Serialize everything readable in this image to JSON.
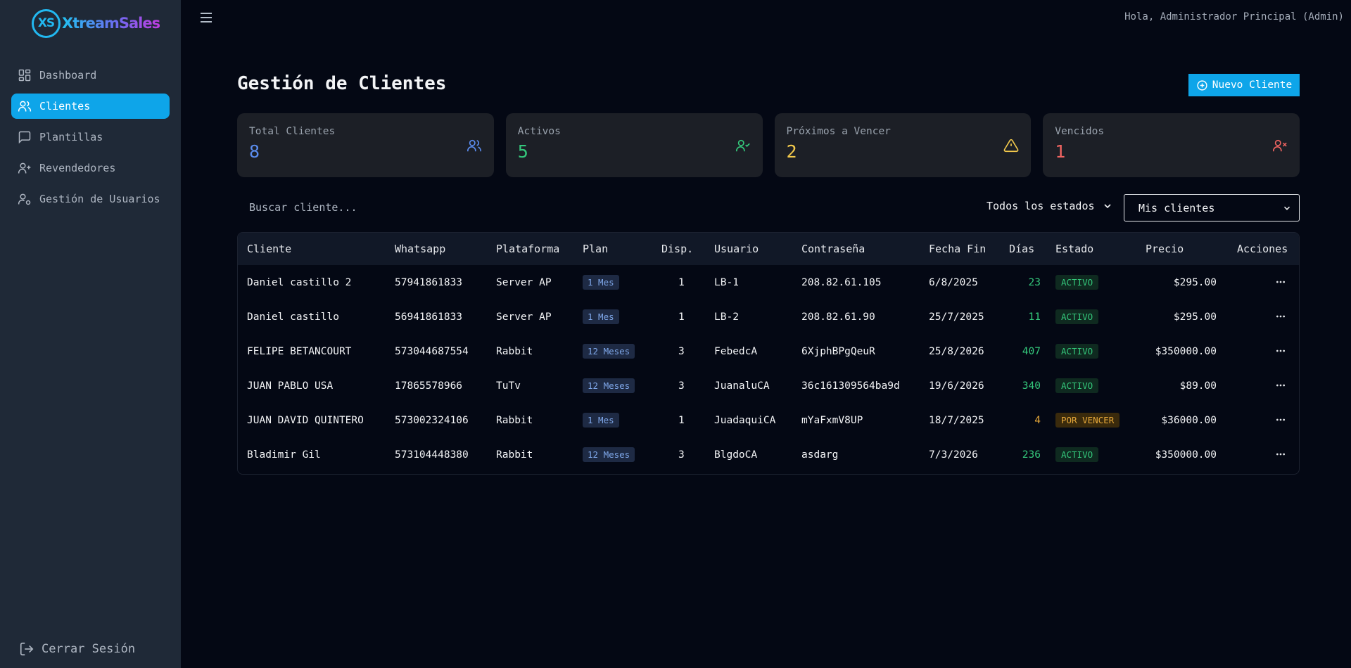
{
  "brand": {
    "mark": "XS",
    "name": "XtreamSales"
  },
  "sidebar": {
    "items": [
      {
        "label": "Dashboard",
        "icon": "dashboard-icon",
        "active": false
      },
      {
        "label": "Clientes",
        "icon": "users-icon",
        "active": true
      },
      {
        "label": "Plantillas",
        "icon": "message-icon",
        "active": false
      },
      {
        "label": "Revendedores",
        "icon": "user-plus-icon",
        "active": false
      },
      {
        "label": "Gestión de Usuarios",
        "icon": "user-cog-icon",
        "active": false
      }
    ],
    "logout_label": "Cerrar Sesión"
  },
  "header": {
    "greeting": "Hola, Administrador Principal (Admin)"
  },
  "page": {
    "title": "Gestión de Clientes",
    "new_button": "Nuevo Cliente"
  },
  "stats": [
    {
      "label": "Total Clientes",
      "value": "8",
      "color": "#5b8def",
      "icon": "users-icon"
    },
    {
      "label": "Activos",
      "value": "5",
      "color": "#34c77b",
      "icon": "user-check-icon"
    },
    {
      "label": "Próximos a Vencer",
      "value": "2",
      "color": "#f2c94c",
      "icon": "warning-icon"
    },
    {
      "label": "Vencidos",
      "value": "1",
      "color": "#ef6461",
      "icon": "user-x-icon"
    }
  ],
  "filters": {
    "search_placeholder": "Buscar cliente...",
    "state_selected": "Todos los estados",
    "owner_selected": "Mis clientes"
  },
  "table": {
    "columns": [
      "Cliente",
      "Whatsapp",
      "Plataforma",
      "Plan",
      "Disp.",
      "Usuario",
      "Contraseña",
      "Fecha Fin",
      "Días",
      "Estado",
      "Precio",
      "Acciones"
    ],
    "rows": [
      {
        "cliente": "Daniel castillo 2",
        "whatsapp": "57941861833",
        "plataforma": "Server AP",
        "plan": "1 Mes",
        "disp": "1",
        "usuario": "LB-1",
        "contrasena": "208.82.61.105",
        "fecha_fin": "6/8/2025",
        "dias": "23",
        "dias_color": "#34c77b",
        "estado": "ACTIVO",
        "estado_kind": "active",
        "precio": "$295.00"
      },
      {
        "cliente": "Daniel castillo",
        "whatsapp": "56941861833",
        "plataforma": "Server AP",
        "plan": "1 Mes",
        "disp": "1",
        "usuario": "LB-2",
        "contrasena": "208.82.61.90",
        "fecha_fin": "25/7/2025",
        "dias": "11",
        "dias_color": "#34c77b",
        "estado": "ACTIVO",
        "estado_kind": "active",
        "precio": "$295.00"
      },
      {
        "cliente": "FELIPE BETANCOURT",
        "whatsapp": "573044687554",
        "plataforma": "Rabbit",
        "plan": "12 Meses",
        "disp": "3",
        "usuario": "FebedcA",
        "contrasena": "6XjphBPgQeuR",
        "fecha_fin": "25/8/2026",
        "dias": "407",
        "dias_color": "#34c77b",
        "estado": "ACTIVO",
        "estado_kind": "active",
        "precio": "$350000.00"
      },
      {
        "cliente": "JUAN PABLO USA",
        "whatsapp": "17865578966",
        "plataforma": "TuTv",
        "plan": "12 Meses",
        "disp": "3",
        "usuario": "JuanaluCA",
        "contrasena": "36c161309564ba9d",
        "fecha_fin": "19/6/2026",
        "dias": "340",
        "dias_color": "#34c77b",
        "estado": "ACTIVO",
        "estado_kind": "active",
        "precio": "$89.00"
      },
      {
        "cliente": "JUAN DAVID QUINTERO",
        "whatsapp": "573002324106",
        "plataforma": "Rabbit",
        "plan": "1 Mes",
        "disp": "1",
        "usuario": "JuadaquiCA",
        "contrasena": "mYaFxmV8UP",
        "fecha_fin": "18/7/2025",
        "dias": "4",
        "dias_color": "#e8a93a",
        "estado": "POR VENCER",
        "estado_kind": "soon",
        "precio": "$36000.00"
      },
      {
        "cliente": "Bladimir Gil",
        "whatsapp": "573104448380",
        "plataforma": "Rabbit",
        "plan": "12 Meses",
        "disp": "3",
        "usuario": "BlgdoCA",
        "contrasena": "asdarg",
        "fecha_fin": "7/3/2026",
        "dias": "236",
        "dias_color": "#34c77b",
        "estado": "ACTIVO",
        "estado_kind": "active",
        "precio": "$350000.00"
      }
    ]
  }
}
